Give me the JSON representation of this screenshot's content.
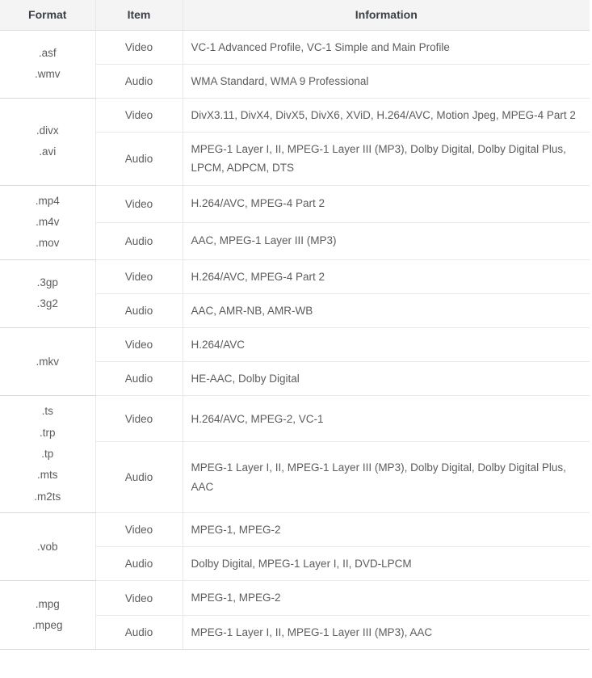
{
  "table": {
    "headers": {
      "format": "Format",
      "item": "Item",
      "information": "Information"
    },
    "groups": [
      {
        "extensions": [
          ".asf",
          ".wmv"
        ],
        "rows": [
          {
            "item": "Video",
            "info": "VC-1 Advanced Profile, VC-1 Simple and Main Profile"
          },
          {
            "item": "Audio",
            "info": "WMA Standard, WMA 9 Professional"
          }
        ]
      },
      {
        "extensions": [
          ".divx",
          ".avi"
        ],
        "rows": [
          {
            "item": "Video",
            "info": "DivX3.11, DivX4, DivX5, DivX6, XViD, H.264/AVC, Motion Jpeg, MPEG-4 Part 2"
          },
          {
            "item": "Audio",
            "info": "MPEG-1 Layer I, II, MPEG-1 Layer III (MP3), Dolby Digital, Dolby Digital Plus, LPCM, ADPCM, DTS"
          }
        ]
      },
      {
        "extensions": [
          ".mp4",
          ".m4v",
          ".mov"
        ],
        "rows": [
          {
            "item": "Video",
            "info": "H.264/AVC, MPEG-4 Part 2"
          },
          {
            "item": "Audio",
            "info": "AAC, MPEG-1 Layer III (MP3)"
          }
        ]
      },
      {
        "extensions": [
          ".3gp",
          ".3g2"
        ],
        "rows": [
          {
            "item": "Video",
            "info": "H.264/AVC, MPEG-4 Part 2"
          },
          {
            "item": "Audio",
            "info": "AAC, AMR-NB, AMR-WB"
          }
        ]
      },
      {
        "extensions": [
          ".mkv"
        ],
        "rows": [
          {
            "item": "Video",
            "info": "H.264/AVC"
          },
          {
            "item": "Audio",
            "info": "HE-AAC, Dolby Digital"
          }
        ]
      },
      {
        "extensions": [
          ".ts",
          ".trp",
          ".tp",
          ".mts",
          ".m2ts"
        ],
        "rows": [
          {
            "item": "Video",
            "info": "H.264/AVC, MPEG-2, VC-1"
          },
          {
            "item": "Audio",
            "info": "MPEG-1 Layer I, II, MPEG-1 Layer III (MP3), Dolby Digital, Dolby Digital Plus, AAC"
          }
        ]
      },
      {
        "extensions": [
          ".vob"
        ],
        "rows": [
          {
            "item": "Video",
            "info": "MPEG-1, MPEG-2"
          },
          {
            "item": "Audio",
            "info": "Dolby Digital, MPEG-1 Layer I, II, DVD-LPCM"
          }
        ]
      },
      {
        "extensions": [
          ".mpg",
          ".mpeg"
        ],
        "rows": [
          {
            "item": "Video",
            "info": "MPEG-1, MPEG-2"
          },
          {
            "item": "Audio",
            "info": "MPEG-1 Layer I, II, MPEG-1 Layer III (MP3), AAC"
          }
        ]
      }
    ]
  },
  "colors": {
    "header_background": "#f4f4f4",
    "header_text": "#3b3f45",
    "body_text": "#5c5c5c",
    "border": "#e8e8e8",
    "group_border": "#d9d9d9"
  }
}
